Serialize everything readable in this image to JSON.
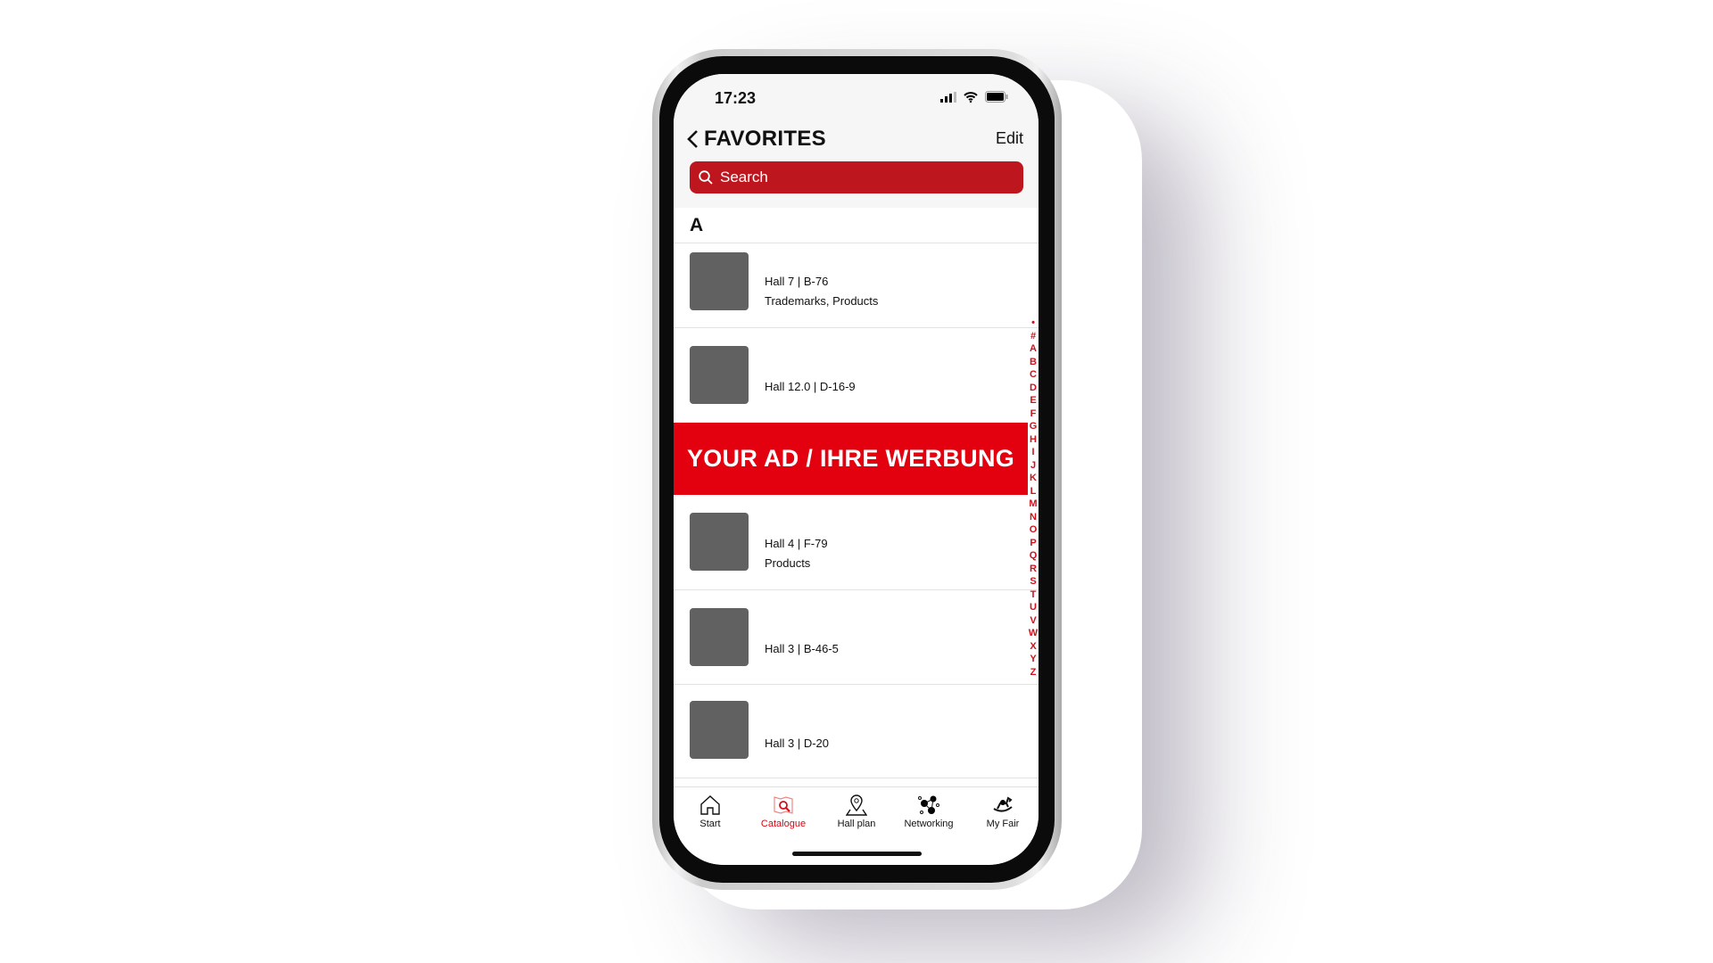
{
  "status": {
    "time": "17:23"
  },
  "header": {
    "title": "FAVORITES",
    "edit_label": "Edit"
  },
  "search": {
    "placeholder": "Search"
  },
  "section": "A",
  "items": [
    {
      "location": "Hall 7 | B-76",
      "tags": "Trademarks,  Products"
    },
    {
      "location": "Hall 12.0 | D-16-9",
      "tags": ""
    },
    {
      "location": "Hall 4 | F-79",
      "tags": "Products"
    },
    {
      "location": "Hall 3 | B-46-5",
      "tags": ""
    },
    {
      "location": "Hall 3 | D-20",
      "tags": ""
    }
  ],
  "ad": {
    "text": "YOUR AD / IHRE WERBUNG"
  },
  "index": [
    "•",
    "#",
    "A",
    "B",
    "C",
    "D",
    "E",
    "F",
    "G",
    "H",
    "I",
    "J",
    "K",
    "L",
    "M",
    "N",
    "O",
    "P",
    "Q",
    "R",
    "S",
    "T",
    "U",
    "V",
    "W",
    "X",
    "Y",
    "Z"
  ],
  "tabs": [
    {
      "label": "Start",
      "icon": "home-icon"
    },
    {
      "label": "Catalogue",
      "icon": "catalogue-icon",
      "active": true
    },
    {
      "label": "Hall plan",
      "icon": "map-pin-icon"
    },
    {
      "label": "Networking",
      "icon": "network-icon"
    },
    {
      "label": "My Fair",
      "icon": "rocking-horse-icon"
    }
  ],
  "colors": {
    "accent": "#e3000f",
    "search_bg": "#bd161e",
    "thumb": "#616161"
  }
}
